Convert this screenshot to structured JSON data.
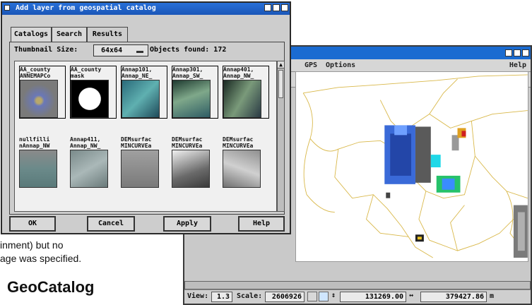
{
  "doc_fragments": {
    "line1": "inment) but no",
    "line2": "age was specified.",
    "heading": "GeoCatalog"
  },
  "dialog": {
    "title": "Add layer from geospatial catalog",
    "tabs": [
      {
        "label": "Catalogs",
        "active": false
      },
      {
        "label": "Search",
        "active": false
      },
      {
        "label": "Results",
        "active": true
      }
    ],
    "thumbnail_size_label": "Thumbnail Size:",
    "thumbnail_size_value": "64x64",
    "objects_found": "Objects found: 172",
    "thumbnails": [
      {
        "line1": "AA_county",
        "line2": "ANNEMAPCo",
        "kind": "county"
      },
      {
        "line1": "AA_county",
        "line2": "mask",
        "kind": "mask"
      },
      {
        "line1": "Annap101,",
        "line2": "Annap_NE_",
        "kind": "aerial-teal"
      },
      {
        "line1": "Annap301,",
        "line2": "Annap_SW_",
        "kind": "aerial-green"
      },
      {
        "line1": "Annap401,",
        "line2": "Annap_NW_",
        "kind": "aerial-dark"
      },
      {
        "line1": "nullfilli",
        "line2": "nAnnap_NW",
        "kind": "gray-aerial"
      },
      {
        "line1": "Annap411,",
        "line2": "Annap_NW_",
        "kind": "gray-aerial2"
      },
      {
        "line1": "DEMsurfac",
        "line2": "MINCURVEa",
        "kind": "dem1"
      },
      {
        "line1": "DEMsurfac",
        "line2": "MINCURVEa",
        "kind": "dem2"
      },
      {
        "line1": "DEMsurfac",
        "line2": "MINCURVEa",
        "kind": "dem3"
      }
    ],
    "buttons": {
      "ok": "OK",
      "cancel": "Cancel",
      "apply": "Apply",
      "help": "Help"
    }
  },
  "map_window": {
    "menus": {
      "gps": "GPS",
      "options": "Options",
      "help": "Help"
    },
    "status": {
      "view_label": "View:",
      "view_value": "1.3",
      "scale_label": "Scale:",
      "scale_value": "2606926",
      "x_value": "131269.00",
      "y_value": "379427.86",
      "unit": "m"
    }
  },
  "colors": {
    "titlebar": "#1a62c8",
    "map_outline": "#d9b84a"
  }
}
